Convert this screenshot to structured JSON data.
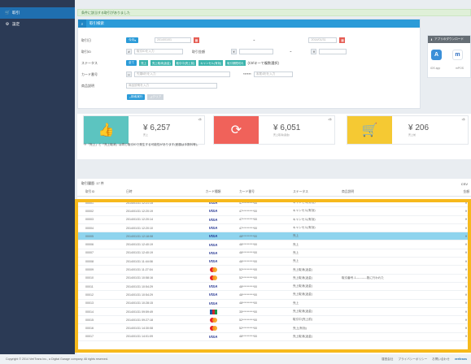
{
  "sidebar": {
    "items": [
      {
        "label": "取引",
        "icon": "cart-icon",
        "active": true
      },
      {
        "label": "設定",
        "icon": "gear-icon",
        "active": false
      }
    ]
  },
  "alert": {
    "text": "条件に該当する取引がありました"
  },
  "search": {
    "title": "取引検索",
    "date_label": "取引日",
    "date_preset": "今月",
    "date_from": "2014/01/01",
    "date_to": "2014/01/31",
    "date_sep": "~",
    "amount_label": "取引金額",
    "amount_sep": "~",
    "amount_unit": "¥",
    "txid_label": "取引ID",
    "txid_placeholder": "取引IDを入力",
    "txid_prefix": "#",
    "status_label": "ステータス",
    "status_buttons": [
      "全て",
      "売上",
      "売上取消(返金)",
      "取引中(売上前)",
      "キャンセル(有効)",
      "取引期限切れ"
    ],
    "status_hint": "(Ctrlキーで複数選択)",
    "card_label": "カード番号",
    "card_placeholder": "先頭6桁を入力",
    "card_mask": "******",
    "card_last_placeholder": "末尾4桁を入力",
    "item_label": "商品説明",
    "item_placeholder": "商品説明を入力",
    "search_button": "検索実行",
    "clear_button": "クリア"
  },
  "app": {
    "title": "アプリのダウンロード",
    "ios_label": "iOS app",
    "other_label": "mPOS"
  },
  "stats": {
    "cards": [
      {
        "value": "¥ 6,257",
        "sub": "売上",
        "tag": "1件",
        "color": "#5cc4c0",
        "icon": "thumbs-up-icon"
      },
      {
        "value": "¥ 6,051",
        "sub": "売上取消(返金)",
        "tag": "2件",
        "color": "#f0625a",
        "icon": "refresh-icon"
      },
      {
        "value": "¥ 206",
        "sub": "売上前",
        "tag": "1件",
        "color": "#f5c933",
        "icon": "cart-icon"
      }
    ],
    "note": "※「売上」と「売上取消」は同じ取引IDで発生する可能性があります(差額は手数料等)。"
  },
  "list": {
    "title": "取引履歴: 17 件",
    "export_label": "CSV"
  },
  "table": {
    "headers": [
      "取引ID",
      "日時",
      "カード種類",
      "カード番号",
      "ステータス",
      "商品説明",
      "金額"
    ],
    "rows": [
      {
        "id": "00001",
        "date": "2014/01/31 12:21:15",
        "brand": "VISA",
        "card": "47**********00",
        "status": "キャンセル(有効)",
        "desc": "",
        "amount": "¥ 1"
      },
      {
        "id": "00002",
        "date": "2014/01/31 12:20:19",
        "brand": "VISA",
        "card": "47**********00",
        "status": "キャンセル(有効)",
        "desc": "",
        "amount": "¥ 1"
      },
      {
        "id": "00003",
        "date": "2014/01/31 12:20:14",
        "brand": "VISA",
        "card": "47**********00",
        "status": "キャンセル(有効)",
        "desc": "",
        "amount": "¥ 1"
      },
      {
        "id": "00004",
        "date": "2014/01/31 12:20:10",
        "brand": "VISA",
        "card": "47**********00",
        "status": "キャンセル(有効)",
        "desc": "",
        "amount": "¥ 1"
      },
      {
        "id": "00005",
        "date": "2014/01/31 12:18:08",
        "brand": "VISA",
        "card": "48**********00",
        "status": "売上",
        "desc": "",
        "amount": "¥ 1"
      },
      {
        "id": "00006",
        "date": "2014/01/31 12:40:19",
        "brand": "VISA",
        "card": "48**********00",
        "status": "売上",
        "desc": "",
        "amount": "¥ 1"
      },
      {
        "id": "00007",
        "date": "2014/01/31 12:40:19",
        "brand": "VISA",
        "card": "48**********00",
        "status": "売上",
        "desc": "",
        "amount": "¥ 1"
      },
      {
        "id": "00008",
        "date": "2014/01/31 11:44:08",
        "brand": "VISA",
        "card": "48**********00",
        "status": "売上",
        "desc": "",
        "amount": "¥ 1"
      },
      {
        "id": "00009",
        "date": "2014/01/31 11:27:04",
        "brand": "MC",
        "card": "52**********00",
        "status": "売上取消(返金)",
        "desc": "",
        "amount": "¥ 1"
      },
      {
        "id": "00010",
        "date": "2014/01/31 10:58:16",
        "brand": "MC",
        "card": "52**********00",
        "status": "売上取消(返金)",
        "desc": "取引番号-1-----------既に行われた",
        "amount": "¥ 1"
      },
      {
        "id": "00011",
        "date": "2014/01/31 10:54:29",
        "brand": "VISA",
        "card": "48**********00",
        "status": "売上取消(返金)",
        "desc": "",
        "amount": "¥ 1"
      },
      {
        "id": "00012",
        "date": "2014/01/31 10:54:29",
        "brand": "VISA",
        "card": "48**********00",
        "status": "売上取消(返金)",
        "desc": "",
        "amount": "¥ 1"
      },
      {
        "id": "00013",
        "date": "2014/01/31 10:28:15",
        "brand": "VISA",
        "card": "48**********00",
        "status": "売上",
        "desc": "",
        "amount": "¥ 1"
      },
      {
        "id": "00014",
        "date": "2014/01/31 09:59:49",
        "brand": "JCB",
        "card": "35**********00",
        "status": "売上取消(返金)",
        "desc": "",
        "amount": "¥ 1"
      },
      {
        "id": "00015",
        "date": "2014/01/31 09:27:18",
        "brand": "MC",
        "card": "52**********00",
        "status": "取引中(売上前)",
        "desc": "",
        "amount": "¥ 1"
      },
      {
        "id": "00016",
        "date": "2014/01/31 14:30:08",
        "brand": "MC",
        "card": "52**********00",
        "status": "売上(有効)",
        "desc": "",
        "amount": "¥ 1"
      },
      {
        "id": "00017",
        "date": "2014/01/31 14:01:09",
        "brand": "VISA",
        "card": "48**********00",
        "status": "売上取消(返金)",
        "desc": "",
        "amount": "¥ 1"
      }
    ]
  },
  "footer": {
    "copyright": "Copyright © 2014 VeriTrans Inc., a Digital Garage company. All rights reserved.",
    "links": [
      "運営会社",
      "プライバシーポリシー",
      "お問い合わせ"
    ],
    "brand": "veritrans"
  },
  "colors": {
    "sidebar": "#2b3a55",
    "accent": "#2b9bd8",
    "highlight_frame": "#f6b91c",
    "selected_row": "#8fd4ee"
  }
}
